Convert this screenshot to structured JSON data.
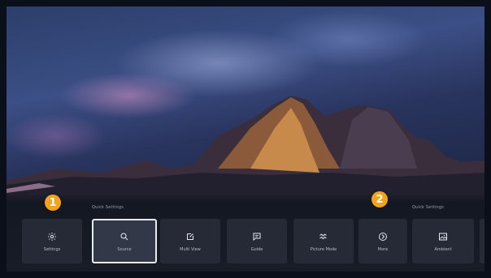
{
  "groups": [
    {
      "id": "quick",
      "label": "Quick Settings"
    },
    {
      "id": "quick-apps",
      "label": "Quick Settings"
    }
  ],
  "tiles": [
    {
      "label": "Settings",
      "icon": "gear-icon"
    },
    {
      "label": "Source",
      "icon": "search-icon"
    },
    {
      "label": "Multi View",
      "icon": "edit-icon"
    },
    {
      "label": "Guide",
      "icon": "chat-icon"
    },
    {
      "label": "Picture Mode",
      "icon": "waves-icon"
    },
    {
      "label": "More",
      "icon": "chevron-right-circle-icon"
    },
    {
      "label": "Ambient",
      "icon": "image-icon"
    }
  ],
  "badges": [
    "1",
    "2"
  ],
  "colors": {
    "badge": "#f2a21c",
    "focus_border": "#e8ebf0",
    "tile_bg": "#252a36"
  }
}
